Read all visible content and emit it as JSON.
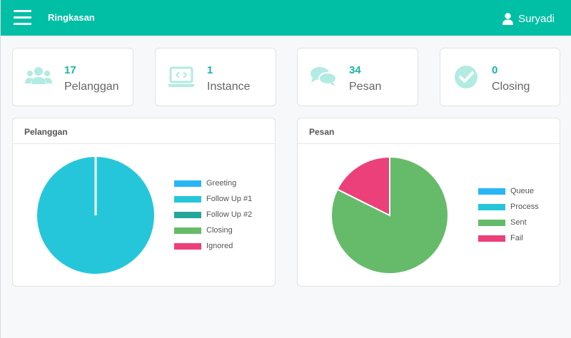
{
  "header": {
    "title": "Ringkasan",
    "user_name": "Suryadi",
    "background": "#00bfa5"
  },
  "stats": [
    {
      "value": "17",
      "label": "Pelanggan",
      "icon": "users-icon"
    },
    {
      "value": "1",
      "label": "Instance",
      "icon": "laptop-code-icon"
    },
    {
      "value": "34",
      "label": "Pesan",
      "icon": "comments-icon"
    },
    {
      "value": "0",
      "label": "Closing",
      "icon": "check-circle-icon"
    }
  ],
  "panels": {
    "pelanggan": {
      "title": "Pelanggan",
      "legend": [
        {
          "label": "Greeting",
          "color": "#29b6f6"
        },
        {
          "label": "Follow Up #1",
          "color": "#26c6da"
        },
        {
          "label": "Follow Up #2",
          "color": "#26a69a"
        },
        {
          "label": "Closing",
          "color": "#66bb6a"
        },
        {
          "label": "Ignored",
          "color": "#ec407a"
        }
      ]
    },
    "pesan": {
      "title": "Pesan",
      "legend": [
        {
          "label": "Queue",
          "color": "#29b6f6"
        },
        {
          "label": "Process",
          "color": "#26c6da"
        },
        {
          "label": "Sent",
          "color": "#66bb6a"
        },
        {
          "label": "Fail",
          "color": "#ec407a"
        }
      ]
    }
  },
  "chart_data": [
    {
      "type": "pie",
      "title": "Pelanggan",
      "categories": [
        "Greeting",
        "Follow Up #1",
        "Follow Up #2",
        "Closing",
        "Ignored"
      ],
      "values": [
        0,
        17,
        0,
        0,
        0
      ],
      "colors": [
        "#29b6f6",
        "#26c6da",
        "#26a69a",
        "#66bb6a",
        "#ec407a"
      ],
      "legend": "right"
    },
    {
      "type": "pie",
      "title": "Pesan",
      "categories": [
        "Queue",
        "Process",
        "Sent",
        "Fail"
      ],
      "values": [
        0,
        0,
        28,
        6
      ],
      "colors": [
        "#29b6f6",
        "#26c6da",
        "#66bb6a",
        "#ec407a"
      ],
      "legend": "right"
    }
  ]
}
